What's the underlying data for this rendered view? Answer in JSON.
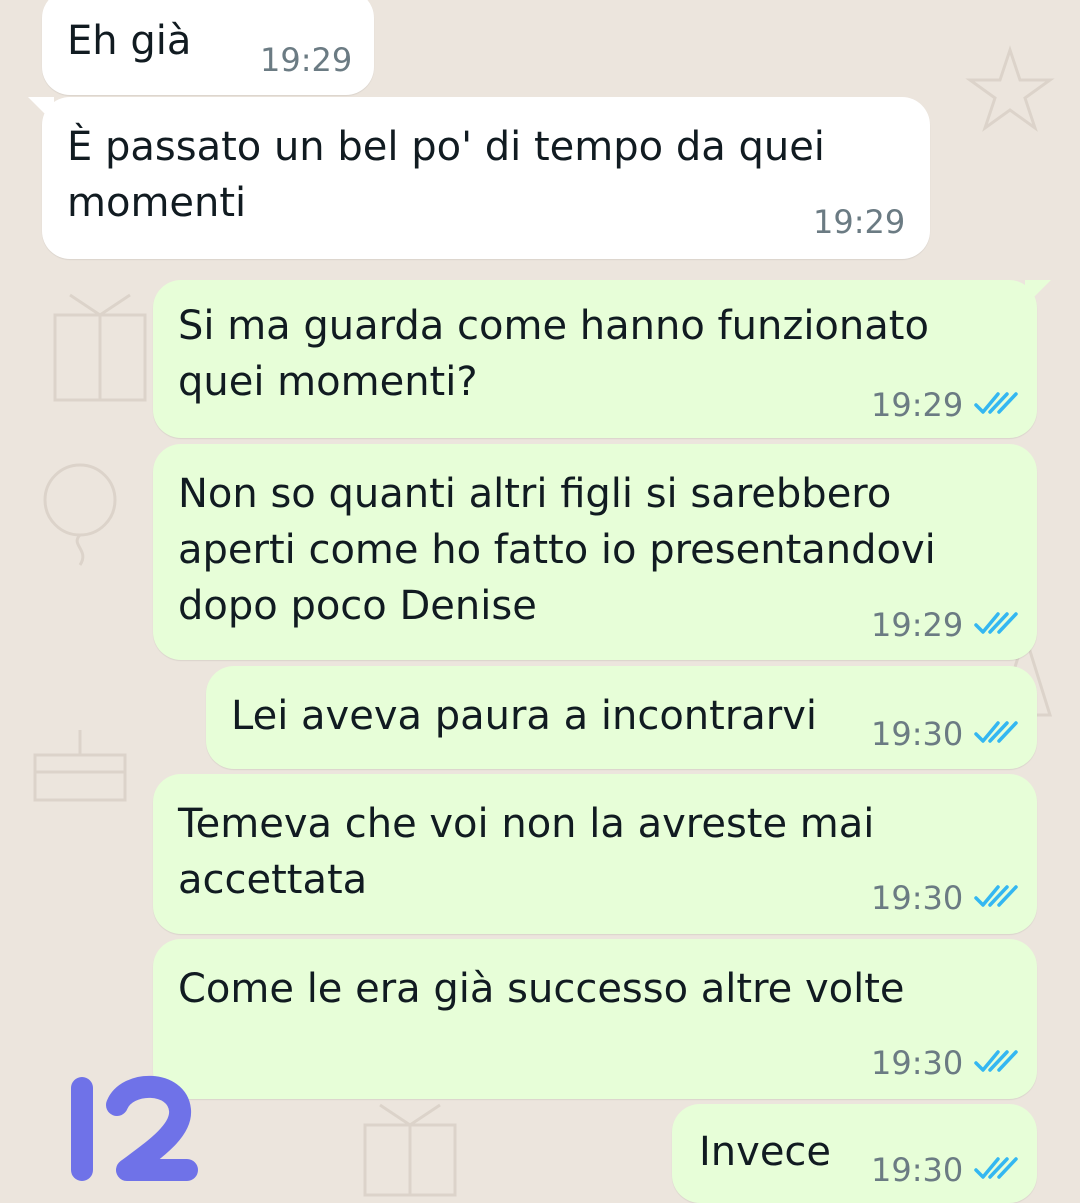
{
  "colors": {
    "chat_background": "#ece5dd",
    "incoming_bubble": "#ffffff",
    "outgoing_bubble": "#e7fed8",
    "read_ticks": "#34b7f1",
    "timestamp": "#6b7b83",
    "sticker_badge": "#6f72e8"
  },
  "messages": [
    {
      "text": "Eh già",
      "time": "19:29",
      "direction": "incoming"
    },
    {
      "text": "È passato un bel po' di tempo da quei\nmomenti",
      "time": "19:29",
      "direction": "incoming"
    },
    {
      "text": "Si ma guarda come hanno funzionato\nquei momenti?",
      "time": "19:29",
      "direction": "outgoing",
      "status": "read"
    },
    {
      "text": "Non so quanti altri figli si sarebbero\naperti come ho fatto io presentandovi\ndopo poco Denise",
      "time": "19:29",
      "direction": "outgoing",
      "status": "read"
    },
    {
      "text": "Lei aveva paura a incontrarvi",
      "time": "19:30",
      "direction": "outgoing",
      "status": "read"
    },
    {
      "text": "Temeva che voi non la avreste mai\naccettata",
      "time": "19:30",
      "direction": "outgoing",
      "status": "read"
    },
    {
      "text": "Come le era già successo altre volte",
      "time": "19:30",
      "direction": "outgoing",
      "status": "read"
    },
    {
      "text": "Invece",
      "time": "19:30",
      "direction": "outgoing",
      "status": "read"
    }
  ],
  "overlay_badge": {
    "label": "12",
    "icon": "number-overlay-icon"
  }
}
